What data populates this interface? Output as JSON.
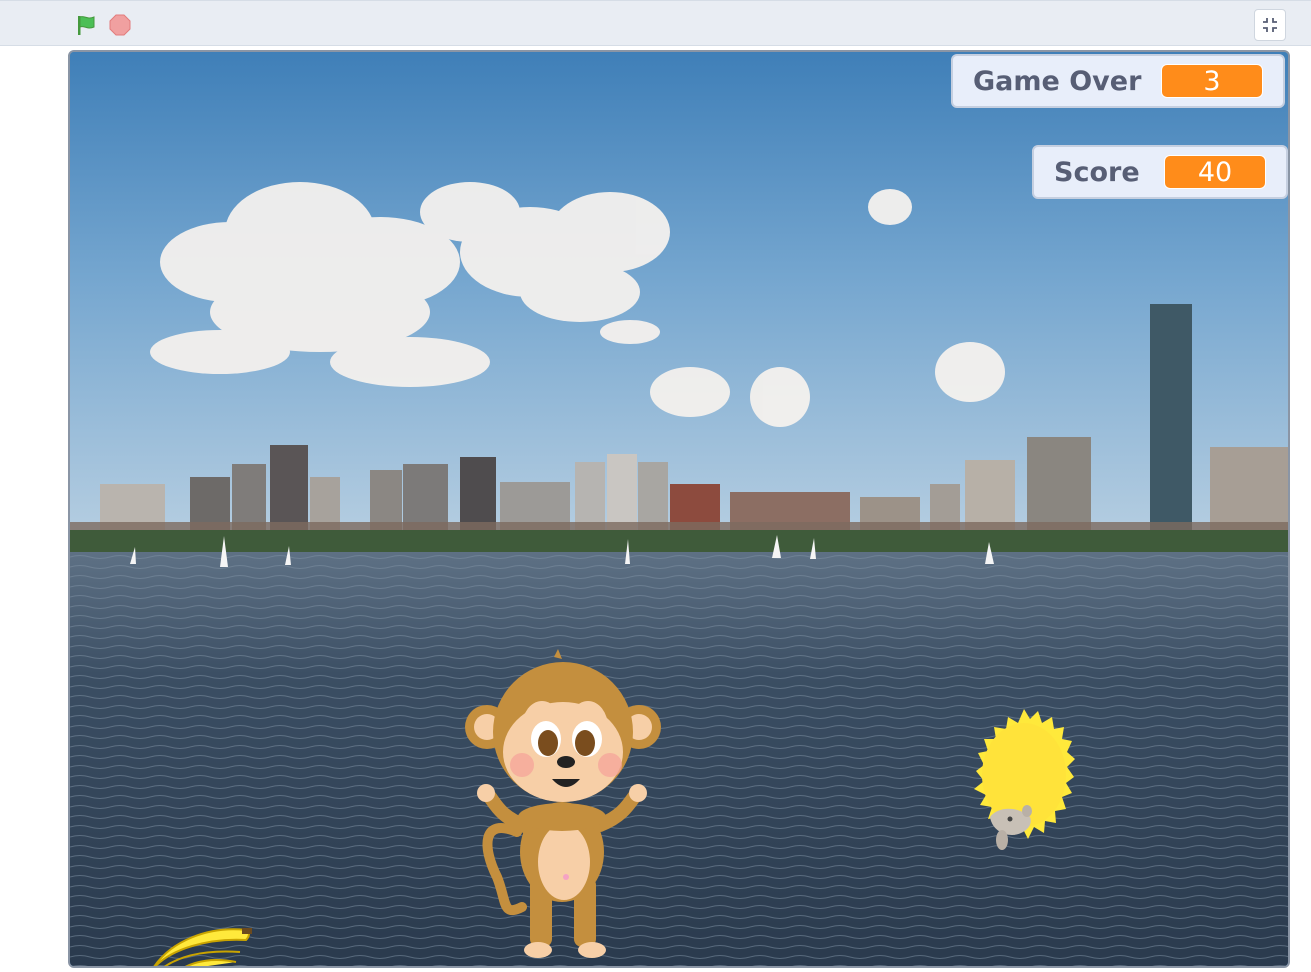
{
  "toolbar": {
    "green_flag_icon": "green-flag-icon",
    "stop_icon": "stop-icon",
    "fullscreen_icon": "exit-fullscreen-icon"
  },
  "monitors": [
    {
      "label": "Game Over",
      "value": "3"
    },
    {
      "label": "Score",
      "value": "40"
    }
  ],
  "sprites": [
    "monkey",
    "hedgehog",
    "bananas"
  ],
  "colors": {
    "monitor_value_bg": "#ff8c1a",
    "monitor_label": "#575e75",
    "monitor_bg": "#e8eefa",
    "flag_green": "#4cbf56",
    "stop_red": "#ec5959"
  }
}
